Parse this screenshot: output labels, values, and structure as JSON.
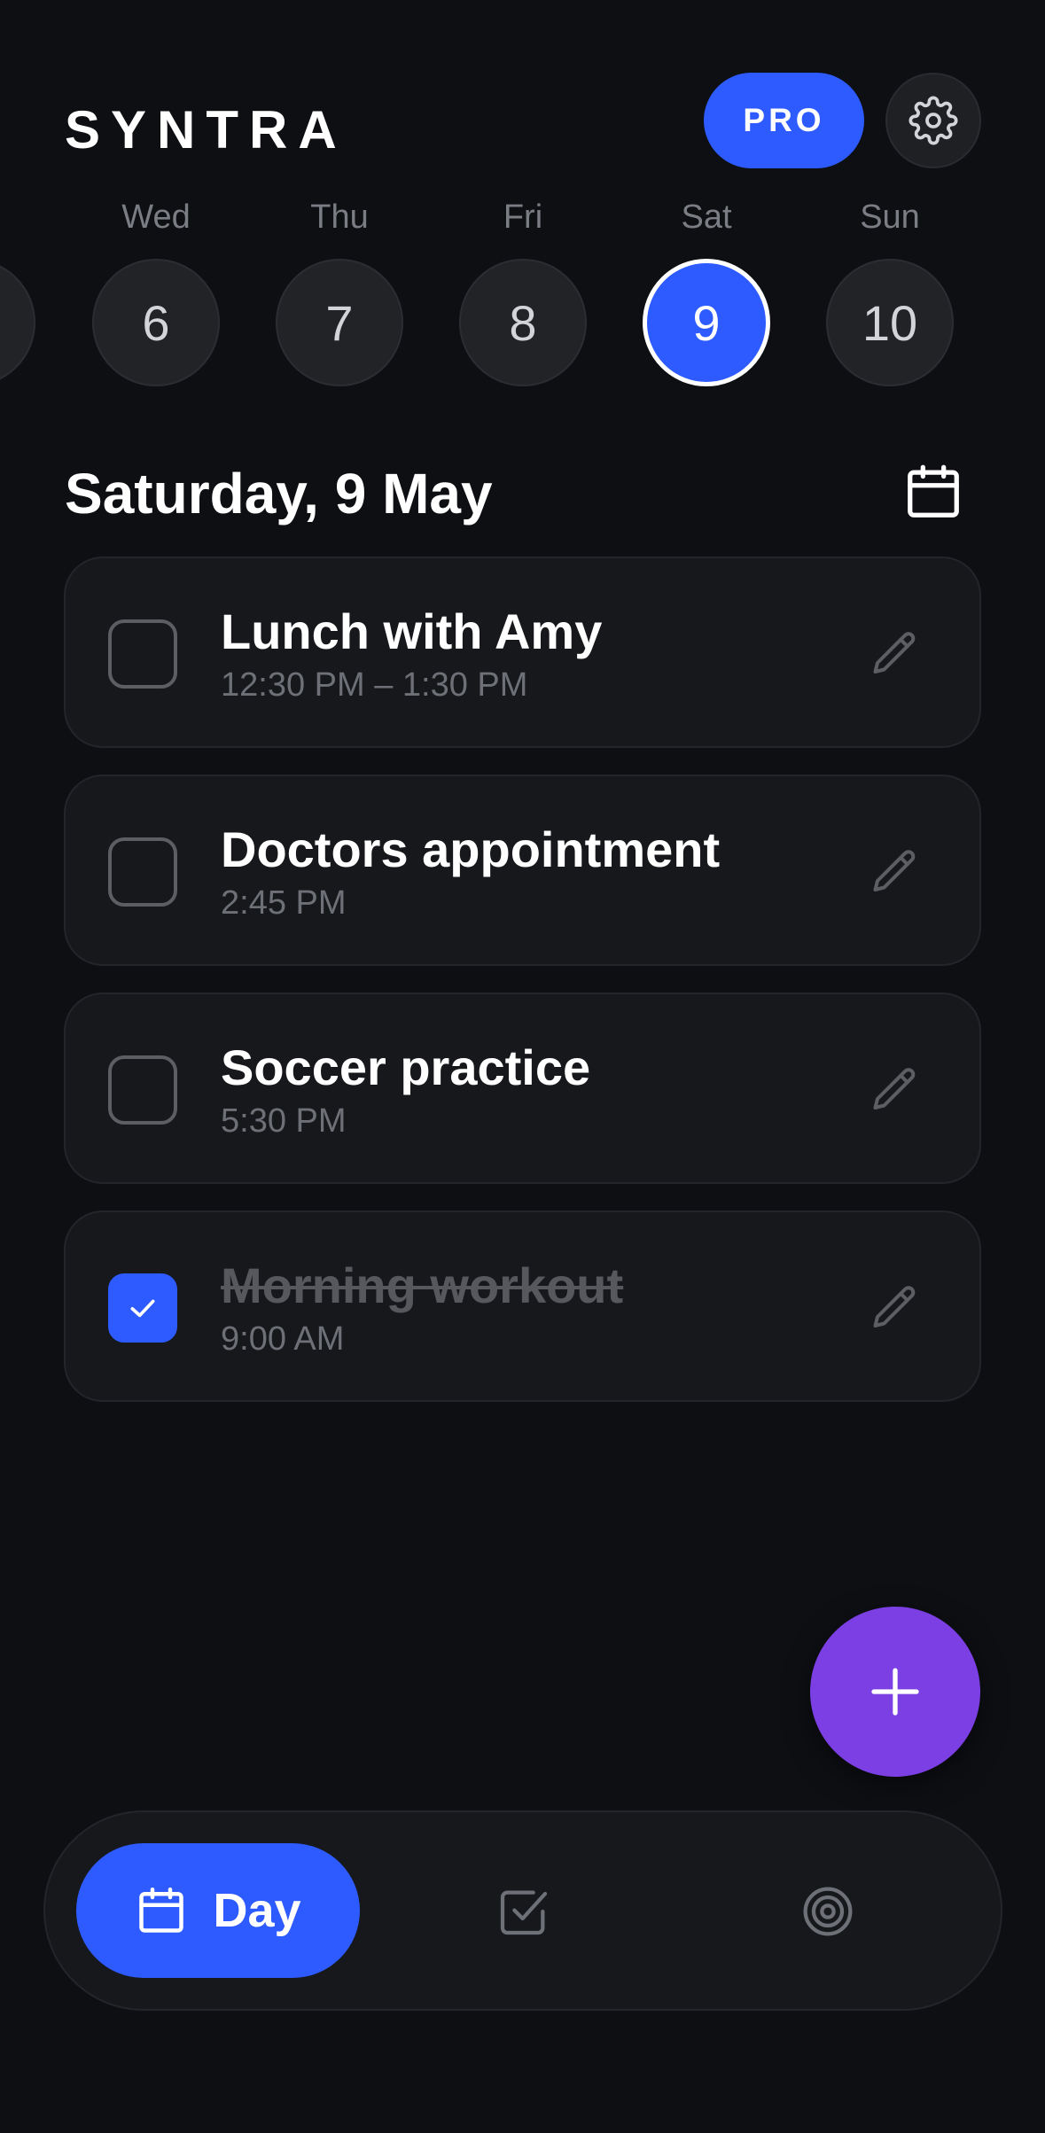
{
  "app": {
    "logo": "SYNTRA",
    "pro_label": "PRO"
  },
  "week": [
    {
      "name": "Wed",
      "num": "6"
    },
    {
      "name": "Thu",
      "num": "7"
    },
    {
      "name": "Fri",
      "num": "8"
    },
    {
      "name": "Sat",
      "num": "9",
      "selected": true
    },
    {
      "name": "Sun",
      "num": "10"
    }
  ],
  "date_title": "Saturday, 9 May",
  "events": [
    {
      "title": "Lunch with Amy",
      "time": "12:30 PM – 1:30 PM",
      "done": false
    },
    {
      "title": "Doctors appointment",
      "time": "2:45 PM",
      "done": false
    },
    {
      "title": "Soccer practice",
      "time": "5:30 PM",
      "done": false
    },
    {
      "title": "Morning workout",
      "time": "9:00 AM",
      "done": true
    }
  ],
  "nav": {
    "day_label": "Day"
  },
  "icons": {
    "settings": "gear-icon",
    "calendar": "calendar-icon",
    "edit": "pencil-icon",
    "check": "check-icon",
    "add": "plus-icon",
    "tasks": "checkbox-icon",
    "goals": "target-icon"
  },
  "colors": {
    "background": "#0e0f13",
    "accent": "#2d5bff",
    "fab": "#7b3fe4",
    "card": "#17181c"
  }
}
